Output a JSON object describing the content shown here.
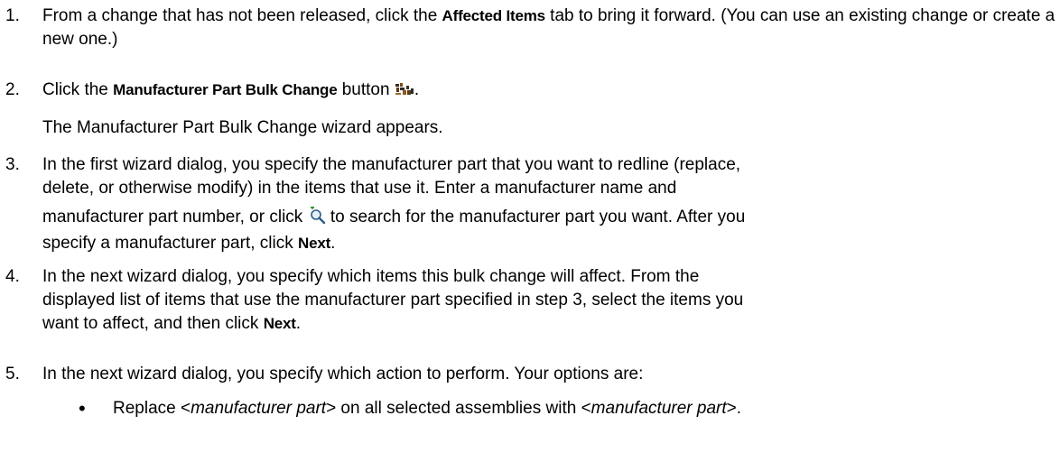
{
  "steps": [
    {
      "number": "1.",
      "pre": "From a change that has not been released, click the ",
      "bold": "Affected Items",
      "post": " tab to bring it forward. (You can use an existing change or create a new one.)"
    },
    {
      "number": "2.",
      "pre": "Click the ",
      "bold": "Manufacturer Part Bulk Change",
      "mid": " button ",
      "post": ".",
      "icon": "bulk-change-icon",
      "note": "The Manufacturer Part Bulk Change wizard appears."
    },
    {
      "number": "3.",
      "line1": "In the first wizard dialog, you specify the manufacturer part that you want to redline (replace,",
      "line2": "delete, or otherwise modify) in the items that use it. Enter a manufacturer name and",
      "line3_pre": "manufacturer part number, or click ",
      "line3_post": " to search for the manufacturer part you want. After you",
      "line4_pre": "specify a manufacturer part, click ",
      "bold": "Next",
      "line4_post": ".",
      "icon": "search-add-icon"
    },
    {
      "number": "4.",
      "line1": "In the next wizard dialog, you specify which items this bulk change will affect. From the",
      "line2": "displayed list of items that use the manufacturer part specified in step 3, select the items you",
      "line3_pre": "want to affect, and then click ",
      "bold": "Next",
      "line3_post": "."
    },
    {
      "number": "5.",
      "text": "In the next wizard dialog, you specify which action to perform. Your options are:",
      "bullets": [
        {
          "symbol": "•",
          "pre": "Replace <",
          "italic1": "manufacturer part",
          "mid": "> on all selected assemblies with <",
          "italic2": "manufacturer part",
          "post": ">."
        }
      ]
    }
  ]
}
